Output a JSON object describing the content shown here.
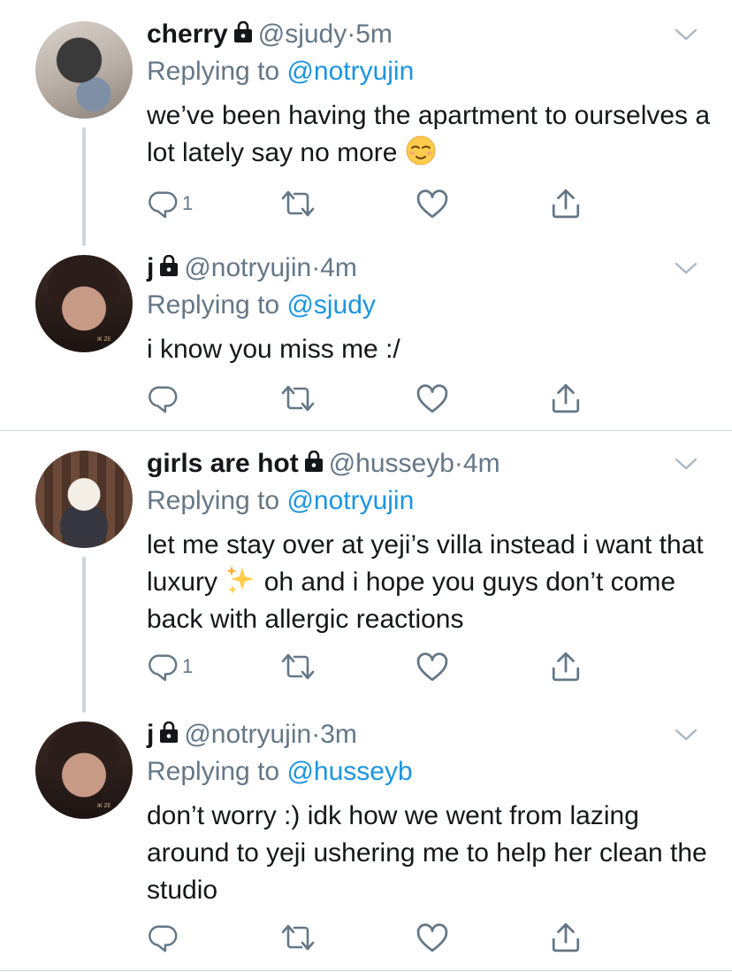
{
  "tweets": [
    {
      "name": "cherry",
      "handle": "@sjudy",
      "dot": "·",
      "time": "5m",
      "reply_prefix": "Replying to ",
      "reply_to": "@notryujin",
      "body_before": "we’ve been having the apartment to ourselves a lot lately say no more ",
      "emoji": "relieved-face-emoji",
      "reply_count": "1"
    },
    {
      "name": "j",
      "handle": "@notryujin",
      "dot": "·",
      "time": "4m",
      "reply_prefix": "Replying to ",
      "reply_to": "@sjudy",
      "body": "i know you miss me :/",
      "reply_count": ""
    },
    {
      "name": "girls are hot",
      "handle": "@husseyb",
      "dot": "·",
      "time": "4m",
      "reply_prefix": "Replying to ",
      "reply_to": "@notryujin",
      "body_before": "let me stay over at yeji’s villa instead i want that luxury ",
      "emoji": "sparkles-emoji",
      "body_after": " oh and i hope you guys don’t come back with allergic reactions",
      "reply_count": "1"
    },
    {
      "name": "j",
      "handle": "@notryujin",
      "dot": "·",
      "time": "3m",
      "reply_prefix": "Replying to ",
      "reply_to": "@husseyb",
      "body": "don’t worry :) idk how we went from lazing around to yeji ushering me to help her clean the studio",
      "reply_count": ""
    }
  ],
  "avatar_watermark": "IK ZE",
  "icons": [
    "lock-icon",
    "chevron-down-icon",
    "reply-icon",
    "retweet-icon",
    "like-icon",
    "share-icon"
  ],
  "colors": {
    "text": "#14171a",
    "secondary": "#657786",
    "link": "#1b95e0",
    "line": "#ccd6dd"
  }
}
